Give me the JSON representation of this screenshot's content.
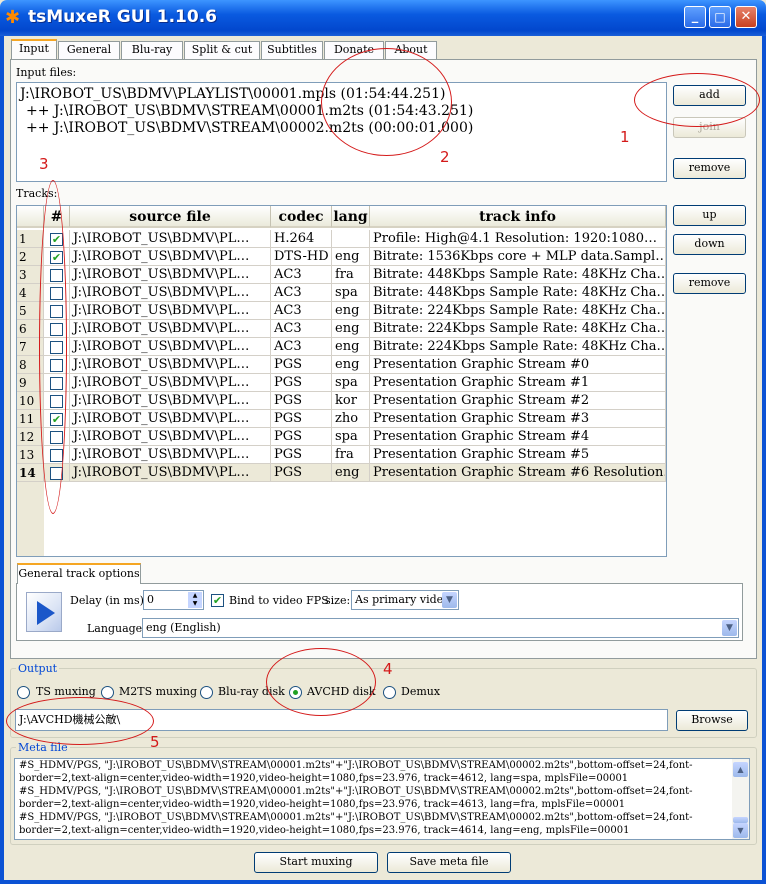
{
  "window": {
    "title": "tsMuxeR GUI 1.10.6",
    "min": "_",
    "max": "□",
    "close": "✕"
  },
  "tabs": [
    "Input",
    "General",
    "Blu-ray",
    "Split & cut",
    "Subtitles",
    "Donate",
    "About"
  ],
  "input": {
    "label": "Input files:",
    "files": [
      "J:\\IROBOT_US\\BDMV\\PLAYLIST\\00001.mpls (01:54:44.251)",
      "++ J:\\IROBOT_US\\BDMV\\STREAM\\00001.m2ts (01:54:43.251)",
      "++ J:\\IROBOT_US\\BDMV\\STREAM\\00002.m2ts (00:00:01.000)"
    ],
    "add": "add",
    "join": "join",
    "remove": "remove"
  },
  "tracks": {
    "label": "Tracks:",
    "headers": [
      "#",
      "source file",
      "codec",
      "lang",
      "track info"
    ],
    "up": "up",
    "down": "down",
    "remove": "remove",
    "rows": [
      {
        "n": "1",
        "checked": true,
        "src": "J:\\IROBOT_US\\BDMV\\PL…",
        "codec": "H.264",
        "lang": "",
        "info": "Profile: High@4.1  Resolution: 1920:1080…"
      },
      {
        "n": "2",
        "checked": true,
        "src": "J:\\IROBOT_US\\BDMV\\PL…",
        "codec": "DTS-HD",
        "lang": "eng",
        "info": "Bitrate: 1536Kbps  core + MLP data.Sampl…"
      },
      {
        "n": "3",
        "checked": false,
        "src": "J:\\IROBOT_US\\BDMV\\PL…",
        "codec": "AC3",
        "lang": "fra",
        "info": "Bitrate: 448Kbps Sample Rate: 48KHz Cha…"
      },
      {
        "n": "4",
        "checked": false,
        "src": "J:\\IROBOT_US\\BDMV\\PL…",
        "codec": "AC3",
        "lang": "spa",
        "info": "Bitrate: 448Kbps Sample Rate: 48KHz Cha…"
      },
      {
        "n": "5",
        "checked": false,
        "src": "J:\\IROBOT_US\\BDMV\\PL…",
        "codec": "AC3",
        "lang": "eng",
        "info": "Bitrate: 224Kbps Sample Rate: 48KHz Cha…"
      },
      {
        "n": "6",
        "checked": false,
        "src": "J:\\IROBOT_US\\BDMV\\PL…",
        "codec": "AC3",
        "lang": "eng",
        "info": "Bitrate: 224Kbps Sample Rate: 48KHz Cha…"
      },
      {
        "n": "7",
        "checked": false,
        "src": "J:\\IROBOT_US\\BDMV\\PL…",
        "codec": "AC3",
        "lang": "eng",
        "info": "Bitrate: 224Kbps Sample Rate: 48KHz Cha…"
      },
      {
        "n": "8",
        "checked": false,
        "src": "J:\\IROBOT_US\\BDMV\\PL…",
        "codec": "PGS",
        "lang": "eng",
        "info": "Presentation Graphic Stream #0"
      },
      {
        "n": "9",
        "checked": false,
        "src": "J:\\IROBOT_US\\BDMV\\PL…",
        "codec": "PGS",
        "lang": "spa",
        "info": "Presentation Graphic Stream #1"
      },
      {
        "n": "10",
        "checked": false,
        "src": "J:\\IROBOT_US\\BDMV\\PL…",
        "codec": "PGS",
        "lang": "kor",
        "info": "Presentation Graphic Stream #2"
      },
      {
        "n": "11",
        "checked": true,
        "src": "J:\\IROBOT_US\\BDMV\\PL…",
        "codec": "PGS",
        "lang": "zho",
        "info": "Presentation Graphic Stream #3"
      },
      {
        "n": "12",
        "checked": false,
        "src": "J:\\IROBOT_US\\BDMV\\PL…",
        "codec": "PGS",
        "lang": "spa",
        "info": "Presentation Graphic Stream #4"
      },
      {
        "n": "13",
        "checked": false,
        "src": "J:\\IROBOT_US\\BDMV\\PL…",
        "codec": "PGS",
        "lang": "fra",
        "info": "Presentation Graphic Stream #5"
      },
      {
        "n": "14",
        "checked": false,
        "src": "J:\\IROBOT_US\\BDMV\\PL…",
        "codec": "PGS",
        "lang": "eng",
        "info": "Presentation Graphic Stream #6 Resolution…"
      }
    ]
  },
  "gto": {
    "tab": "General track options",
    "delay_label": "Delay (in ms):",
    "delay": "0",
    "bind": "Bind to video FPS",
    "size_label": "size:",
    "size": "As primary video",
    "lang_label": "Language:",
    "lang": "eng (English)"
  },
  "output": {
    "label": "Output",
    "options": [
      "TS muxing",
      "M2TS muxing",
      "Blu-ray disk",
      "AVCHD disk",
      "Demux"
    ],
    "selected": 3,
    "path": "J:\\AVCHD機械公敵\\",
    "browse": "Browse"
  },
  "meta": {
    "label": "Meta file",
    "text": "#S_HDMV/PGS, \"J:\\IROBOT_US\\BDMV\\STREAM\\00001.m2ts\"+\"J:\\IROBOT_US\\BDMV\\STREAM\\00002.m2ts\",bottom-offset=24,font-\nborder=2,text-align=center,video-width=1920,video-height=1080,fps=23.976, track=4612, lang=spa, mplsFile=00001\n#S_HDMV/PGS, \"J:\\IROBOT_US\\BDMV\\STREAM\\00001.m2ts\"+\"J:\\IROBOT_US\\BDMV\\STREAM\\00002.m2ts\",bottom-offset=24,font-\nborder=2,text-align=center,video-width=1920,video-height=1080,fps=23.976, track=4613, lang=fra, mplsFile=00001\n#S_HDMV/PGS, \"J:\\IROBOT_US\\BDMV\\STREAM\\00001.m2ts\"+\"J:\\IROBOT_US\\BDMV\\STREAM\\00002.m2ts\",bottom-offset=24,font-\nborder=2,text-align=center,video-width=1920,video-height=1080,fps=23.976, track=4614, lang=eng, mplsFile=00001"
  },
  "actions": {
    "start": "Start muxing",
    "save": "Save meta file"
  },
  "annotations": [
    "1",
    "2",
    "3",
    "4",
    "5"
  ],
  "colors": {
    "titlebar": "#0a5ae0",
    "annotation": "#d41a1a",
    "check": "#21a121"
  }
}
